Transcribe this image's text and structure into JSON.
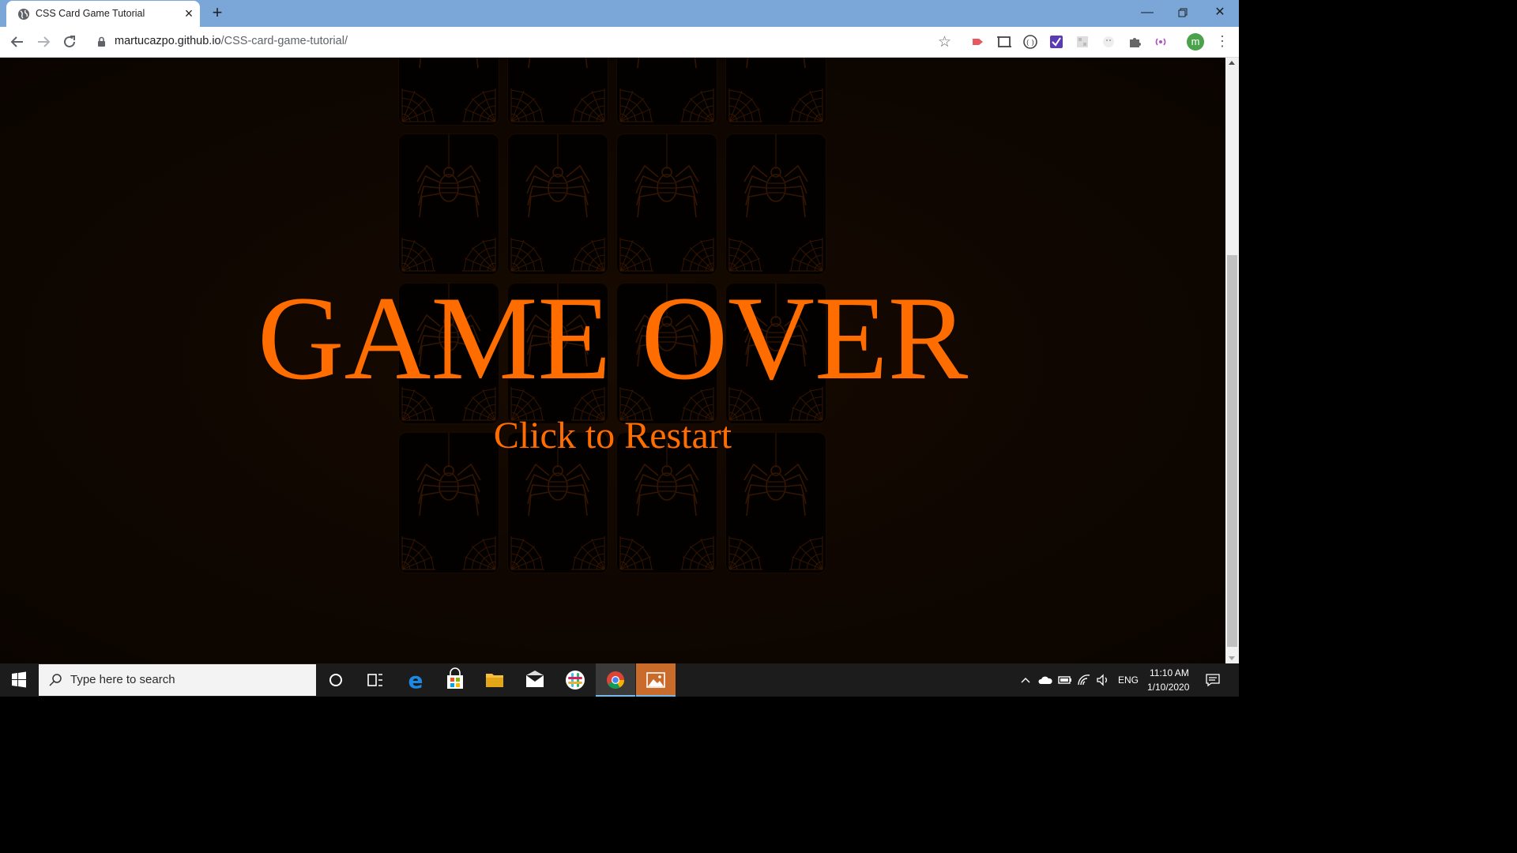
{
  "browser": {
    "tab_title": "CSS Card Game Tutorial",
    "url_host": "martucazpo.github.io",
    "url_path": "/CSS-card-game-tutorial/",
    "profile_initial": "m"
  },
  "game": {
    "overlay_title": "GAME OVER",
    "overlay_subtitle": "Click to Restart",
    "card_rows": 4,
    "card_columns": 4,
    "accent_color": "#ff6d00",
    "card_back": "spider-and-cobweb"
  },
  "taskbar": {
    "search_placeholder": "Type here to search",
    "time": "11:10 AM",
    "date": "1/10/2020",
    "language": "ENG"
  }
}
